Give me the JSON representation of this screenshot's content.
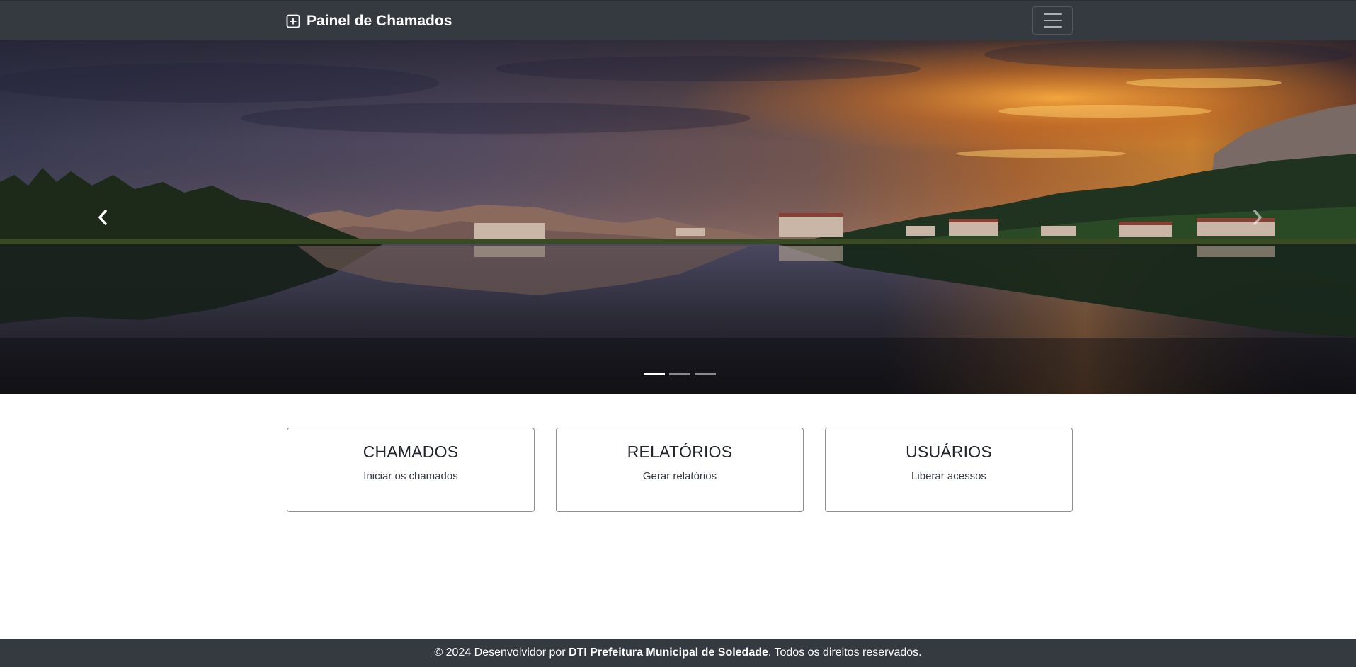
{
  "navbar": {
    "brand": "Painel de Chamados",
    "brand_icon": "plus-square-icon",
    "toggler_icon": "hamburger-menu-icon"
  },
  "carousel": {
    "slide_image": "landscape-lake-sunset-mountains",
    "prev_icon": "chevron-left-icon",
    "next_icon": "chevron-right-icon",
    "slide_count": 3,
    "active_slide": 1
  },
  "cards": [
    {
      "title": "CHAMADOS",
      "text": "Iniciar os chamados"
    },
    {
      "title": "RELATÓRIOS",
      "text": "Gerar relatórios"
    },
    {
      "title": "USUÁRIOS",
      "text": "Liberar acessos"
    }
  ],
  "footer": {
    "prefix": "© 2024 Desenvolvidor por ",
    "org": "DTI Prefeitura Municipal de Soledade",
    "suffix": ". Todos os direitos reservados."
  },
  "colors": {
    "navbar_bg": "#343a40",
    "footer_bg": "#343a40",
    "card_border": "#8a8f94"
  }
}
